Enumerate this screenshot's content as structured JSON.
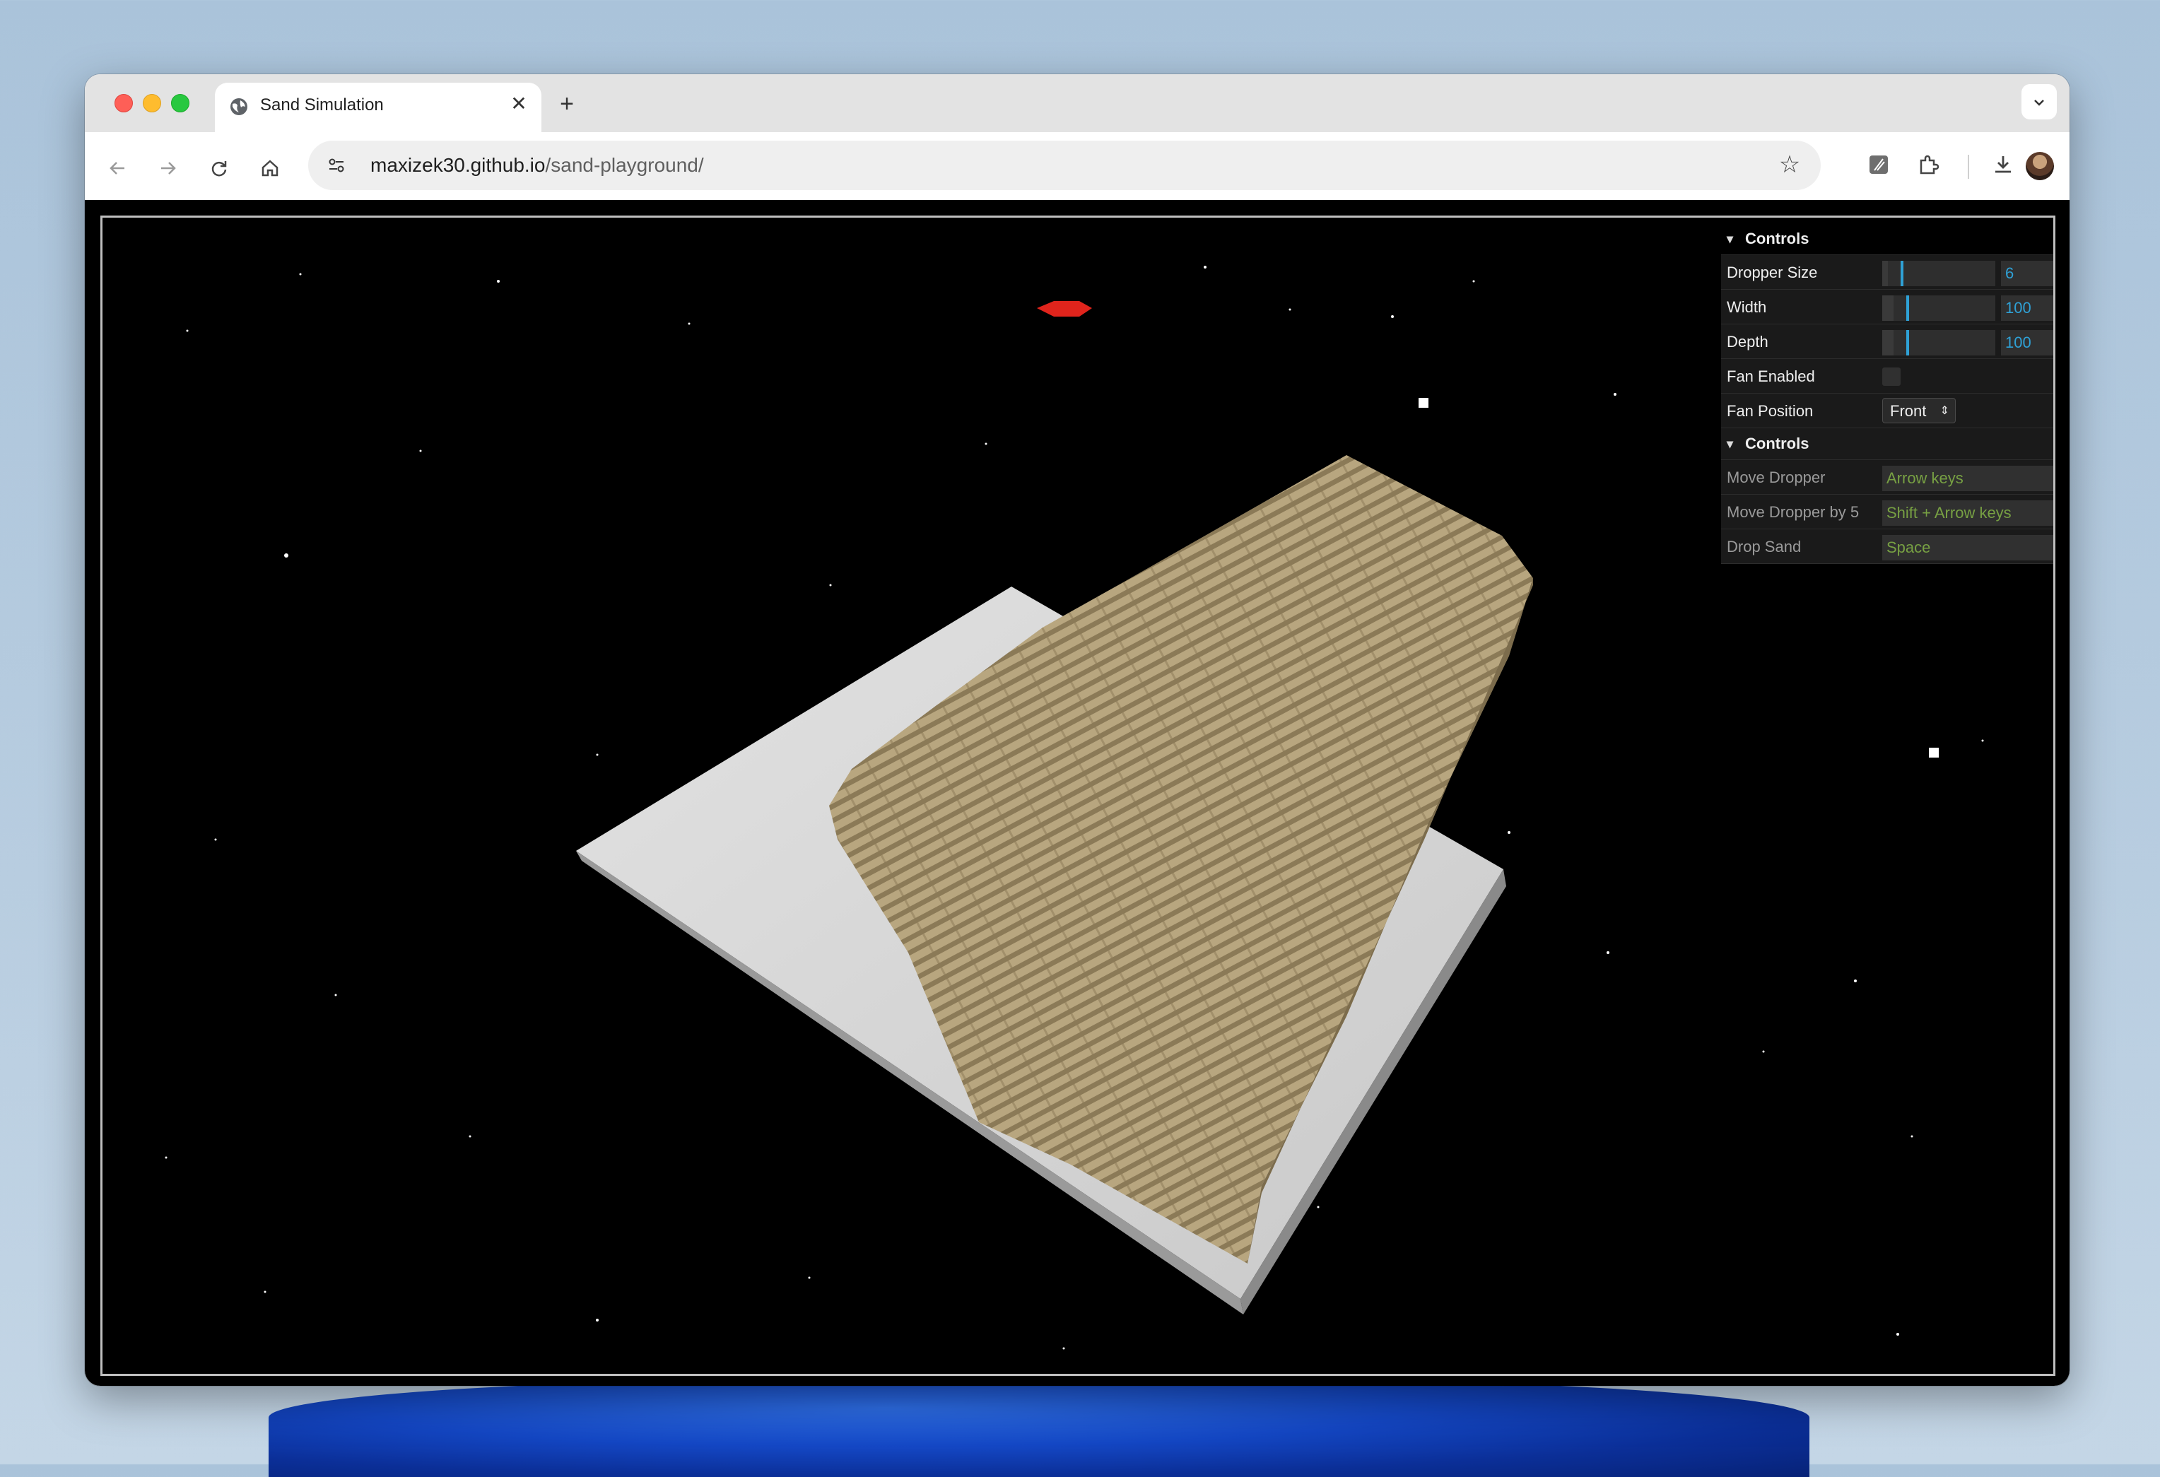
{
  "browser": {
    "tab_title": "Sand Simulation",
    "url_host": "maxizek30.github.io",
    "url_path": "/sand-playground/",
    "icons": [
      "globe-icon",
      "close-icon",
      "plus-icon",
      "chevron-down-icon",
      "back-icon",
      "forward-icon",
      "reload-icon",
      "home-icon",
      "site-info-icon",
      "star-icon",
      "extension-icon",
      "puzzle-icon",
      "download-icon",
      "avatar",
      "kebab-menu-icon"
    ]
  },
  "gui": {
    "folder1_title": "Controls",
    "dropper_size_label": "Dropper Size",
    "dropper_size_value": "6",
    "dropper_size_level": 0.05,
    "width_label": "Width",
    "width_value": "100",
    "width_level": 0.1,
    "depth_label": "Depth",
    "depth_value": "100",
    "depth_level": 0.1,
    "fan_enabled_label": "Fan Enabled",
    "fan_enabled": false,
    "fan_position_label": "Fan Position",
    "fan_position_value": "Front",
    "folder2_title": "Controls",
    "move_dropper_label": "Move Dropper",
    "move_dropper_value": "Arrow keys",
    "move_dropper5_label": "Move Dropper by 5",
    "move_dropper5_value": "Shift + Arrow keys",
    "drop_sand_label": "Drop Sand",
    "drop_sand_value": "Space"
  },
  "colors": {
    "sand": "#b6a47f",
    "sand_dark": "#8c7b58",
    "plate": "#d9d9d9",
    "dropper": "#e0241c",
    "gui_accent": "#2fa1d6",
    "gui_string": "#77a043"
  }
}
